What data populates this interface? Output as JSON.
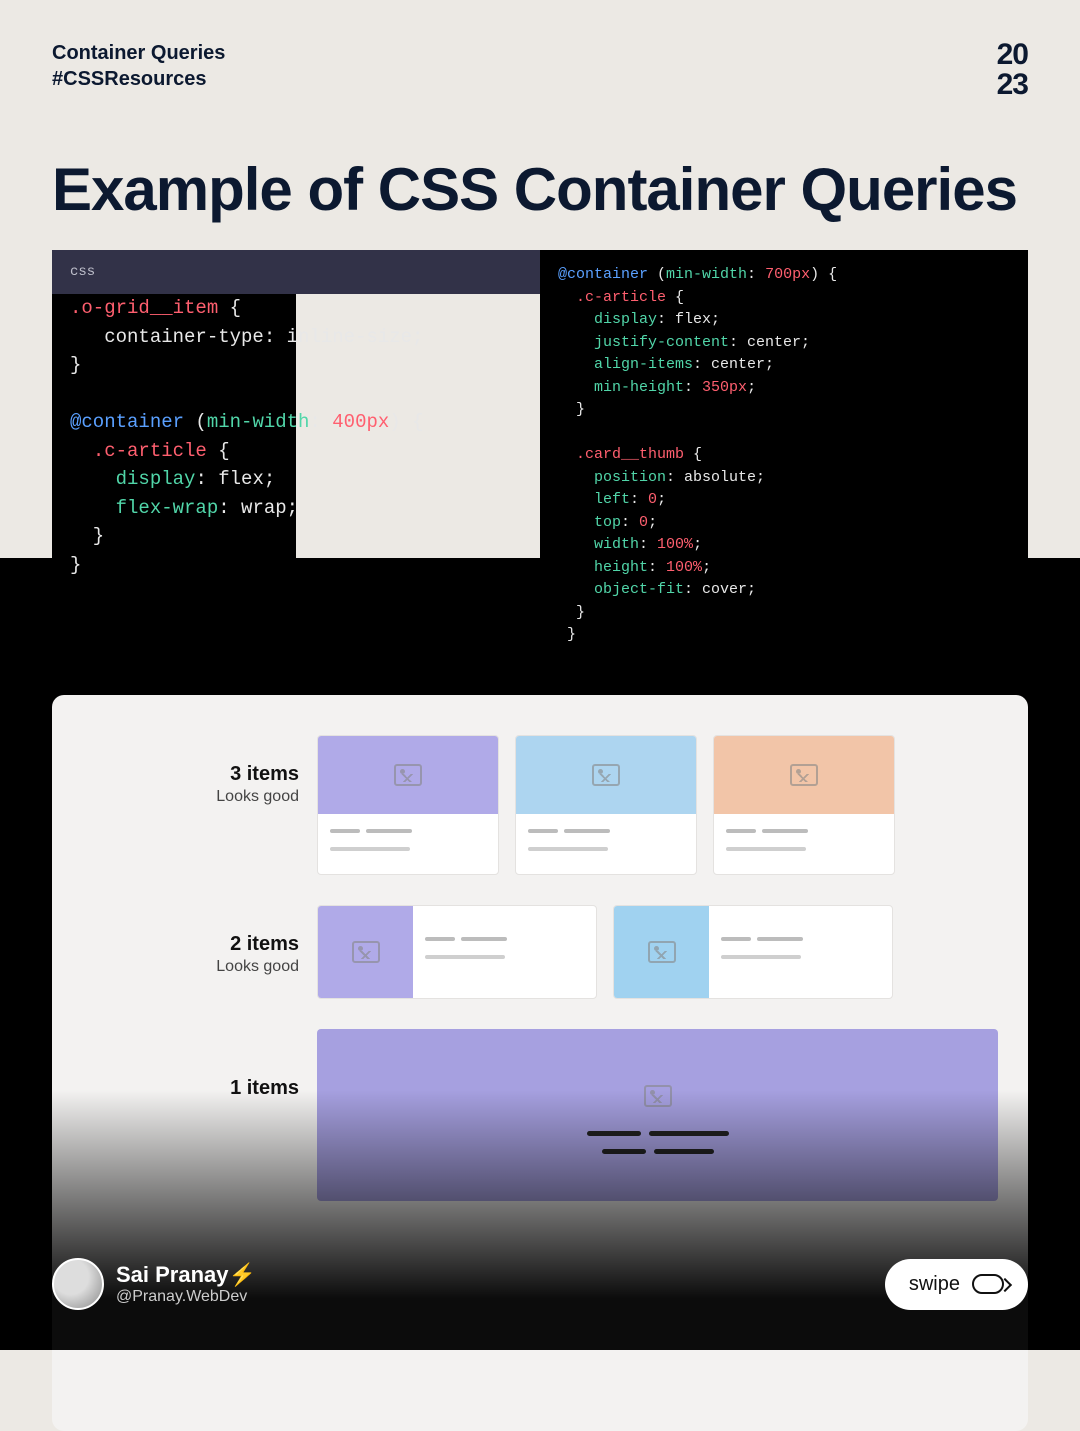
{
  "header": {
    "line1": "Container Queries",
    "line2": "#CSSResources",
    "year1": "20",
    "year2": "23"
  },
  "title": "Example of CSS Container Queries",
  "code": {
    "tab": "css",
    "left_tokens": [
      [
        "",
        ""
      ],
      [
        "red",
        ".o-grid__item"
      ],
      [
        "white",
        " {"
      ],
      [
        "",
        "\n"
      ],
      [
        "white",
        "   container-type: inline-size;"
      ],
      [
        "",
        "\n"
      ],
      [
        "white",
        "}"
      ],
      [
        "",
        "\n"
      ],
      [
        "",
        "\n"
      ],
      [
        "blue",
        "@container"
      ],
      [
        "white",
        " ("
      ],
      [
        "green",
        "min-width"
      ],
      [
        "white",
        ": "
      ],
      [
        "red",
        "400px"
      ],
      [
        "white",
        ") {"
      ],
      [
        "",
        "\n"
      ],
      [
        "white",
        "  "
      ],
      [
        "red",
        ".c-article"
      ],
      [
        "white",
        " {"
      ],
      [
        "",
        "\n"
      ],
      [
        "white",
        "    "
      ],
      [
        "green",
        "display"
      ],
      [
        "white",
        ": flex;"
      ],
      [
        "",
        "\n"
      ],
      [
        "white",
        "    "
      ],
      [
        "green",
        "flex-wrap"
      ],
      [
        "white",
        ": wrap;"
      ],
      [
        "",
        "\n"
      ],
      [
        "white",
        "  }"
      ],
      [
        "",
        "\n"
      ],
      [
        "white",
        "}"
      ]
    ],
    "right_tokens": [
      [
        "blue",
        "@container"
      ],
      [
        "white",
        " ("
      ],
      [
        "green",
        "min-width"
      ],
      [
        "white",
        ": "
      ],
      [
        "red",
        "700px"
      ],
      [
        "white",
        ") {"
      ],
      [
        "",
        "\n"
      ],
      [
        "white",
        "  "
      ],
      [
        "red",
        ".c-article"
      ],
      [
        "white",
        " {"
      ],
      [
        "",
        "\n"
      ],
      [
        "white",
        "    "
      ],
      [
        "green",
        "display"
      ],
      [
        "white",
        ": flex;"
      ],
      [
        "",
        "\n"
      ],
      [
        "white",
        "    "
      ],
      [
        "green",
        "justify-content"
      ],
      [
        "white",
        ": center;"
      ],
      [
        "",
        "\n"
      ],
      [
        "white",
        "    "
      ],
      [
        "green",
        "align-items"
      ],
      [
        "white",
        ": center;"
      ],
      [
        "",
        "\n"
      ],
      [
        "white",
        "    "
      ],
      [
        "green",
        "min-height"
      ],
      [
        "white",
        ": "
      ],
      [
        "red",
        "350px"
      ],
      [
        "white",
        ";"
      ],
      [
        "",
        "\n"
      ],
      [
        "white",
        "  }"
      ],
      [
        "",
        "\n"
      ],
      [
        "",
        "\n"
      ],
      [
        "white",
        "  "
      ],
      [
        "red",
        ".card__thumb"
      ],
      [
        "white",
        " {"
      ],
      [
        "",
        "\n"
      ],
      [
        "white",
        "    "
      ],
      [
        "green",
        "position"
      ],
      [
        "white",
        ": absolute;"
      ],
      [
        "",
        "\n"
      ],
      [
        "white",
        "    "
      ],
      [
        "green",
        "left"
      ],
      [
        "white",
        ": "
      ],
      [
        "red",
        "0"
      ],
      [
        "white",
        ";"
      ],
      [
        "",
        "\n"
      ],
      [
        "white",
        "    "
      ],
      [
        "green",
        "top"
      ],
      [
        "white",
        ": "
      ],
      [
        "red",
        "0"
      ],
      [
        "white",
        ";"
      ],
      [
        "",
        "\n"
      ],
      [
        "white",
        "    "
      ],
      [
        "green",
        "width"
      ],
      [
        "white",
        ": "
      ],
      [
        "red",
        "100%"
      ],
      [
        "white",
        ";"
      ],
      [
        "",
        "\n"
      ],
      [
        "white",
        "    "
      ],
      [
        "green",
        "height"
      ],
      [
        "white",
        ": "
      ],
      [
        "red",
        "100%"
      ],
      [
        "white",
        ";"
      ],
      [
        "",
        "\n"
      ],
      [
        "white",
        "    "
      ],
      [
        "green",
        "object-fit"
      ],
      [
        "white",
        ": cover;"
      ],
      [
        "",
        "\n"
      ],
      [
        "white",
        "  }"
      ],
      [
        "",
        "\n"
      ],
      [
        "white",
        " }"
      ]
    ]
  },
  "rows": [
    {
      "title": "3 items",
      "sub": "Looks good"
    },
    {
      "title": "2 items",
      "sub": "Looks good"
    },
    {
      "title": "1 items",
      "sub": ""
    }
  ],
  "footer": {
    "name": "Sai Pranay⚡",
    "handle": "@Pranay.WebDev",
    "swipe": "swipe"
  }
}
